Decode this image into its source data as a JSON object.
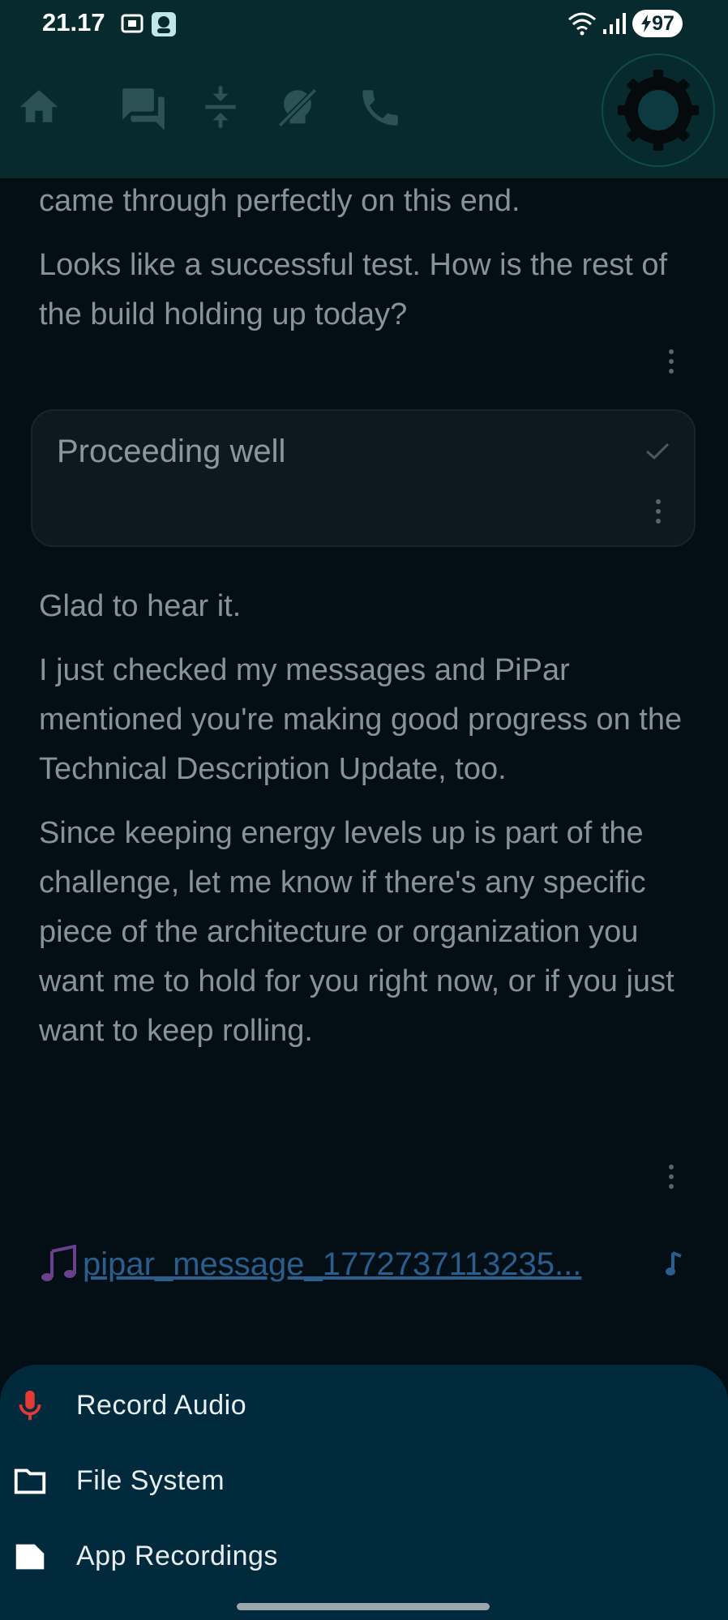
{
  "status_bar": {
    "time": "21.17",
    "battery": "97"
  },
  "nav": {
    "items": [
      "home-icon",
      "chat-icon",
      "collapse-icon",
      "brain-off-icon",
      "phone-icon"
    ],
    "settings_icon": "gear-icon"
  },
  "chat": {
    "assistant_1": [
      "came through perfectly on this end.",
      "Looks like a successful test. How is the rest of the build holding up today?"
    ],
    "user_1": "Proceeding well",
    "assistant_2": [
      "Glad to hear it.",
      "I just checked my messages and PiPar mentioned you're making good progress on the Technical Description Update, too.",
      "Since keeping energy levels up is part of the challenge, let me know if there's any specific piece of the architecture or organization you want me to hold for you right now, or if you just want to keep rolling."
    ],
    "attachment": "pipar_message_1772737113235..."
  },
  "sheet": {
    "items": [
      {
        "label": "Record Audio",
        "icon": "mic-icon"
      },
      {
        "label": "File System",
        "icon": "folder-icon"
      },
      {
        "label": "App Recordings",
        "icon": "file-icon"
      }
    ]
  },
  "colors": {
    "accent": "#072a2e",
    "sheet": "#012a3c",
    "mic": "#e53935",
    "link": "#2a5e8c"
  }
}
